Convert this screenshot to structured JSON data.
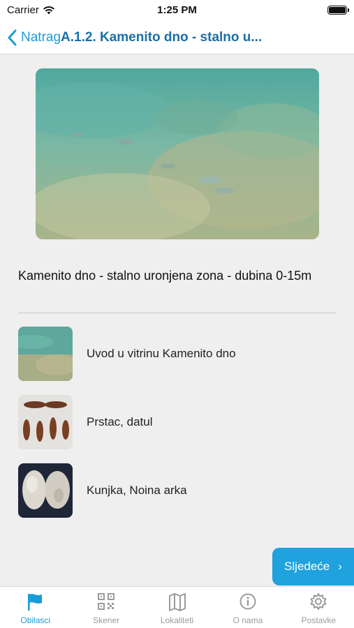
{
  "status_bar": {
    "carrier": "Carrier",
    "time": "1:25 PM"
  },
  "nav": {
    "back_label": "Natrag",
    "title": "A.1.2. Kamenito dno - stalno u..."
  },
  "hero": {
    "icon": "underwater-photo"
  },
  "description": "Kamenito dno - stalno uronjena zona - dubina 0-15m",
  "items": [
    {
      "label": "Uvod u vitrinu Kamenito dno",
      "icon": "underwater-thumbnail"
    },
    {
      "label": "Prstac, datul",
      "icon": "date-mussel-thumbnail"
    },
    {
      "label": "Kunjka, Noina arka",
      "icon": "noah-ark-shell-thumbnail"
    }
  ],
  "next_button": {
    "label": "Sljedeće"
  },
  "tabs": [
    {
      "label": "Obilasci",
      "icon": "flag-icon",
      "active": true
    },
    {
      "label": "Skener",
      "icon": "qr-code-icon",
      "active": false
    },
    {
      "label": "Lokaliteti",
      "icon": "map-icon",
      "active": false
    },
    {
      "label": "O nama",
      "icon": "info-icon",
      "active": false
    },
    {
      "label": "Postavke",
      "icon": "gear-icon",
      "active": false
    }
  ],
  "colors": {
    "accent": "#1a9bd7",
    "title": "#1a6fa8",
    "inactive": "#9b9b9b",
    "background": "#efefef"
  }
}
